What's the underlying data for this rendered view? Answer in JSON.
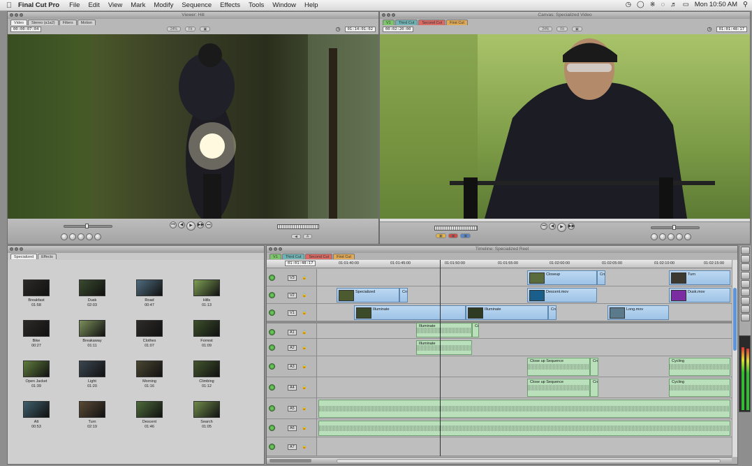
{
  "menubar": {
    "app": "Final Cut Pro",
    "items": [
      "File",
      "Edit",
      "View",
      "Mark",
      "Modify",
      "Sequence",
      "Effects",
      "Tools",
      "Window",
      "Help"
    ],
    "clock": "Mon 10:50 AM"
  },
  "viewer": {
    "title": "Viewer: Hill",
    "tabs": [
      "Video",
      "Stereo (a1a2)",
      "Filters",
      "Motion"
    ],
    "timecode_left": "00:00:07:04",
    "timecode_right": "01:14:01:02",
    "zoom_label": "24%",
    "view_label": "Fit",
    "controls": [
      "⏮",
      "◀",
      "▶",
      "▶▶",
      "⏭"
    ]
  },
  "canvas": {
    "title": "Canvas: Specialized Video",
    "tabs": [
      "V1",
      "Third Cut",
      "Second Cut",
      "First Cut"
    ],
    "timecode_left": "00:02:20:00",
    "timecode_right": "01:01:48:17",
    "zoom_label": "24%",
    "view_label": "Fit"
  },
  "browser": {
    "tabs": [
      "Specialized",
      "Effects"
    ],
    "clips": [
      {
        "name": "Breakfast",
        "dur": "01:58",
        "color": "#2b2a26"
      },
      {
        "name": "Dusk",
        "dur": "02:03",
        "color": "#3a4a2e"
      },
      {
        "name": "Road",
        "dur": "00:47",
        "color": "#4f6c7e"
      },
      {
        "name": "Hills",
        "dur": "01:13",
        "color": "#7f9f55"
      },
      {
        "name": "Bike",
        "dur": "00:27",
        "color": "#2c2a28"
      },
      {
        "name": "Breakaway",
        "dur": "01:11",
        "color": "#7b8f5a"
      },
      {
        "name": "Clothes",
        "dur": "01:07",
        "color": "#2e2c2a"
      },
      {
        "name": "Forrest",
        "dur": "01:09",
        "color": "#3c4f2a"
      },
      {
        "name": "Open Jacket",
        "dur": "01:39",
        "color": "#5f7d3e"
      },
      {
        "name": "Light",
        "dur": "01:20",
        "color": "#3b4650"
      },
      {
        "name": "Morning",
        "dur": "01:16",
        "color": "#4a4632"
      },
      {
        "name": "Climbing",
        "dur": "01:12",
        "color": "#43552e"
      },
      {
        "name": "Alt",
        "dur": "00:53",
        "color": "#3f5f6b"
      },
      {
        "name": "Turn",
        "dur": "02:19",
        "color": "#5a4a36"
      },
      {
        "name": "Descent",
        "dur": "01:46",
        "color": "#4d6a3a"
      },
      {
        "name": "Search",
        "dur": "01:05",
        "color": "#6f8b4a"
      }
    ]
  },
  "timeline": {
    "title": "Timeline: Specialized Reel",
    "tabs": [
      "V1",
      "Third Cut",
      "Second Cut",
      "First Cut"
    ],
    "current_tc": "01:01:48:17",
    "ruler": [
      "01:01:40:00",
      "01:01:45:00",
      "01:01:50:00",
      "01:01:55:00",
      "01:02:00:00",
      "01:02:05:00",
      "01:02:10:00",
      "01:02:15:00"
    ],
    "tracks": [
      "V3",
      "V2",
      "V1",
      "A1",
      "A2",
      "A3",
      "A4",
      "A5",
      "A6",
      "A7"
    ],
    "clips": {
      "closeup": "Closeup",
      "cro1": "Cro",
      "turn": "Turn",
      "specialized": "Specialized",
      "cro2": "Cro",
      "descent": "Descent.mov",
      "dusk": "Dusk.mov",
      "illuminate_v": "Illuminate",
      "illuminate_v2": "Illuminate",
      "cro3": "Cro",
      "long": "Long.mov",
      "illuminate_a1": "Illuminate",
      "cro_a1": "Cro",
      "illuminate_a2": "Illuminate",
      "closeup_seq1": "Close up Sequence",
      "cro_a3": "Cro",
      "cycling1": "Cycling",
      "closeup_seq2": "Close up Sequence",
      "cro_a4": "Cro",
      "cycling2": "Cycling"
    }
  }
}
